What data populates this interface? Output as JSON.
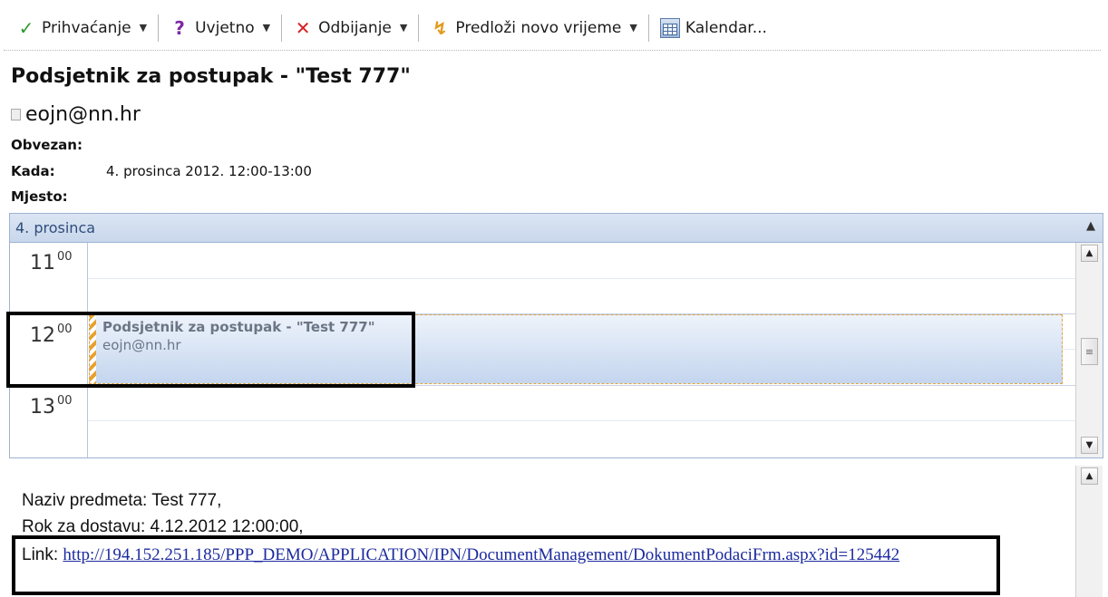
{
  "toolbar": {
    "accept_label": "Prihvaćanje",
    "tentative_label": "Uvjetno",
    "decline_label": "Odbijanje",
    "propose_label": "Predloži novo vrijeme",
    "calendar_label": "Kalendar...",
    "icons": {
      "accept": "checkmark-icon",
      "tentative": "question-mark-icon",
      "decline": "x-icon",
      "propose": "propose-time-icon",
      "calendar": "calendar-icon"
    },
    "colors": {
      "accept": "#2d9a2d",
      "tentative": "#7e2aa8",
      "decline": "#d32121",
      "propose": "#e39a1c"
    }
  },
  "message": {
    "subject": "Podsjetnik za postupak - \"Test 777\"",
    "sender": "eojn@nn.hr",
    "required_label": "Obvezan:",
    "when_label": "Kada:",
    "when_value": "4. prosinca 2012. 12:00-13:00",
    "location_label": "Mjesto:"
  },
  "calendar": {
    "date_header": "4. prosinca",
    "hours": [
      {
        "hour": "11",
        "minutes": "00"
      },
      {
        "hour": "12",
        "minutes": "00"
      },
      {
        "hour": "13",
        "minutes": "00"
      }
    ],
    "appointment": {
      "title": "Podsjetnik za postupak - \"Test 777\"",
      "organizer": "eojn@nn.hr"
    },
    "accent_color": "#c4d5ee",
    "tentative_stripe_color": "#e8a12e"
  },
  "body": {
    "line1": "Naziv predmeta: Test 777,",
    "line2": "Rok za dostavu: 4.12.2012 12:00:00,",
    "link_label": "Link:",
    "link_url": "http://194.152.251.185/PPP_DEMO/APPLICATION/IPN/DocumentManagement/DokumentPodaciFrm.aspx?id=125442",
    "link_color": "#1c2a9e"
  }
}
